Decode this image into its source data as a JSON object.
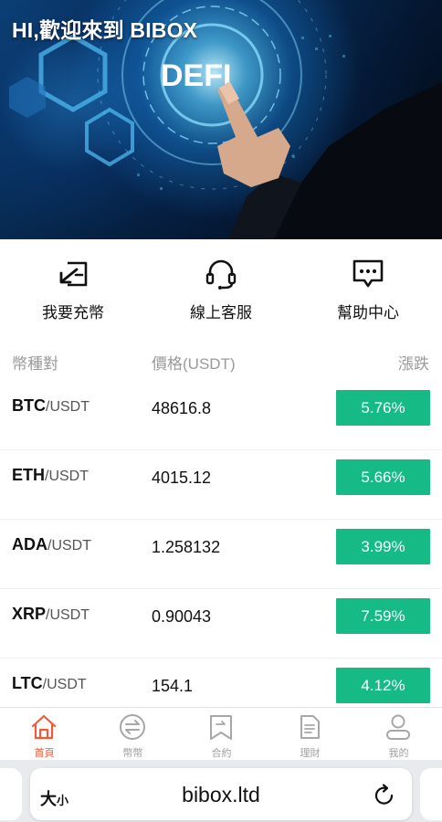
{
  "hero": {
    "greeting": "HI,歡迎來到 BIBOX",
    "banner_text": "DEFI"
  },
  "actions": [
    {
      "label": "我要充幣",
      "icon": "deposit-icon"
    },
    {
      "label": "線上客服",
      "icon": "headset-icon"
    },
    {
      "label": "幫助中心",
      "icon": "chat-bubble-icon"
    }
  ],
  "market": {
    "headers": {
      "pair": "幣種對",
      "price": "價格(USDT)",
      "change": "漲跌"
    },
    "rows": [
      {
        "base": "BTC",
        "quote": "/USDT",
        "price": "48616.8",
        "change": "5.76%"
      },
      {
        "base": "ETH",
        "quote": "/USDT",
        "price": "4015.12",
        "change": "5.66%"
      },
      {
        "base": "ADA",
        "quote": "/USDT",
        "price": "1.258132",
        "change": "3.99%"
      },
      {
        "base": "XRP",
        "quote": "/USDT",
        "price": "0.90043",
        "change": "7.59%"
      },
      {
        "base": "LTC",
        "quote": "/USDT",
        "price": "154.1",
        "change": "4.12%"
      }
    ]
  },
  "tabs": [
    {
      "label": "首頁",
      "icon": "home-icon",
      "active": true
    },
    {
      "label": "幣幣",
      "icon": "exchange-icon",
      "active": false
    },
    {
      "label": "合約",
      "icon": "bookmark-icon",
      "active": false
    },
    {
      "label": "理財",
      "icon": "document-icon",
      "active": false
    },
    {
      "label": "我的",
      "icon": "user-icon",
      "active": false
    }
  ],
  "browser": {
    "text_size_big": "大",
    "text_size_small": "小",
    "url": "bibox.ltd",
    "reload_icon": "reload-icon"
  },
  "colors": {
    "accent": "#f2593a",
    "positive": "#16ba85",
    "muted": "#9a9a9a"
  }
}
